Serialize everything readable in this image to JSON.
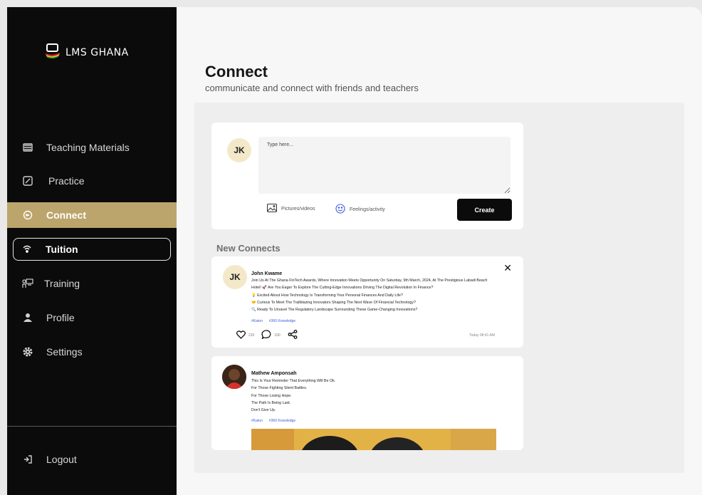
{
  "sidebar": {
    "logo_text": "LMS GHANA",
    "items": [
      {
        "label": "Teaching Materials",
        "icon": "stack-icon"
      },
      {
        "label": "Practice",
        "icon": "edit-box-icon"
      },
      {
        "label": "Connect",
        "icon": "chat-icon",
        "state": "active"
      },
      {
        "label": "Tuition",
        "icon": "broadcast-icon",
        "state": "outlined"
      },
      {
        "label": "Training",
        "icon": "classroom-icon"
      },
      {
        "label": "Profile",
        "icon": "person-icon"
      },
      {
        "label": "Settings",
        "icon": "gear-icon"
      }
    ],
    "logout_label": "Logout"
  },
  "header": {
    "title": "Connect",
    "subtitle": "communicate and connect with friends and teachers"
  },
  "composer": {
    "avatar_initials": "JK",
    "placeholder": "Type here...",
    "pictures_label": "Pictures/videos",
    "feelings_label": "Feelings/activity",
    "create_label": "Create"
  },
  "feed": {
    "section_title": "New Connects",
    "posts": [
      {
        "avatar_initials": "JK",
        "author": "John Kwame",
        "lines": [
          "Join Us At The Ghana FinTech Awards, Where Innovation Meets Opportunity On Saturday, 9th March, 2024, At The Prestigious Labadi Beach",
          "Hotel! 🚀 Are You Eager To Explore The Cutting-Edge Innovations Driving The Digital Revolution In Finance?",
          "💡 Excited About How Technology Is Transforming Your Personal Finances And Daily Life?",
          "🤝 Curious To Meet The Trailblazing Innovators Shaping The Next Wave Of Financial Technology?",
          "🔍 Ready To Unravel The Regulatory Landscape Surrounding These Game-Changing Innovations?"
        ],
        "tags": [
          "#Katon",
          "#360 Knowledge"
        ],
        "likes": "210",
        "comments": "100",
        "timestamp": "Today 08:41 AM"
      },
      {
        "author": "Mathew Amponsah",
        "lines": [
          "This Is Your Reminder That Everything Will Be Ok.",
          "For Those Fighting Silent Battles.",
          "For Those Losing Hope.",
          "The Path Is Being Laid.",
          "Don't Give Up."
        ],
        "tags": [
          "#Katon",
          "#360 Knowledge"
        ]
      }
    ]
  },
  "colors": {
    "sidebar_bg": "#0b0b0b",
    "accent_gold": "#bba56c",
    "button_dark": "#0b0b0b",
    "tag_blue": "#3b5ee0",
    "avatar_bg": "#f3e9c9"
  }
}
